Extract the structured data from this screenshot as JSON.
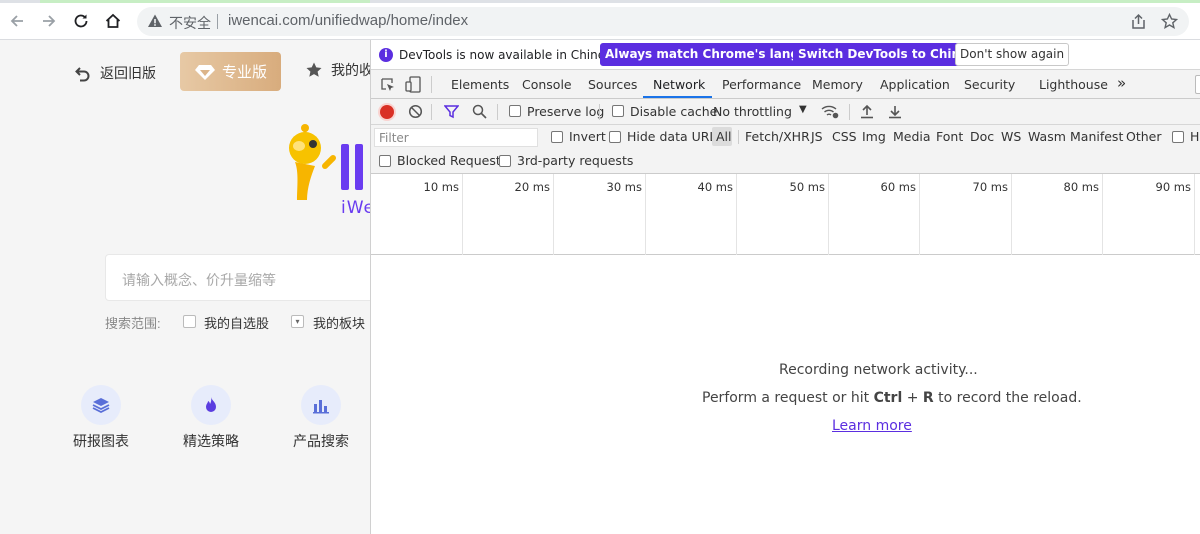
{
  "browser": {
    "not_secure_label": "不安全",
    "url": "iwencai.com/unifiedwap/home/index"
  },
  "page": {
    "old_version_label": "返回旧版",
    "pro_version_label": "专业版",
    "favorites_label": "我的收",
    "brand_text": "iWe",
    "search_placeholder": "请输入概念、价升量缩等",
    "scope_label": "搜索范围:",
    "scope_options": [
      "我的自选股",
      "我的板块"
    ],
    "quick_links": [
      "研报图表",
      "精选策略",
      "产品搜索"
    ]
  },
  "devtools": {
    "info_message": "DevTools is now available in Chinese!",
    "btn_match_language": "Always match Chrome's language",
    "btn_switch_chinese": "Switch DevTools to Chinese",
    "btn_dont_show": "Don't show again",
    "tabs": [
      "Elements",
      "Console",
      "Sources",
      "Network",
      "Performance",
      "Memory",
      "Application",
      "Security",
      "Lighthouse"
    ],
    "active_tab": "Network",
    "more_tabs": "»",
    "preserve_log": "Preserve log",
    "disable_cache": "Disable cache",
    "throttling": "No throttling",
    "filter_placeholder": "Filter",
    "invert": "Invert",
    "hide_data_urls": "Hide data URLs",
    "types": [
      "All",
      "Fetch/XHR",
      "JS",
      "CSS",
      "Img",
      "Media",
      "Font",
      "Doc",
      "WS",
      "Wasm",
      "Manifest",
      "Other"
    ],
    "has_blocked_cookies": "Ha",
    "blocked_requests": "Blocked Requests",
    "third_party": "3rd-party requests",
    "timeline_ticks": [
      "10 ms",
      "20 ms",
      "30 ms",
      "40 ms",
      "50 ms",
      "60 ms",
      "70 ms",
      "80 ms",
      "90 ms"
    ],
    "empty_recording": "Recording network activity...",
    "empty_hint_pre": "Perform a request or hit",
    "empty_key1": "Ctrl",
    "empty_plus": "+",
    "empty_key2": "R",
    "empty_hint_post": "to record the reload.",
    "learn_more": "Learn more"
  },
  "colors": {
    "accent_purple": "#5b2ee0",
    "record_red": "#d93025",
    "pro_gold": "#d8ac7d"
  }
}
